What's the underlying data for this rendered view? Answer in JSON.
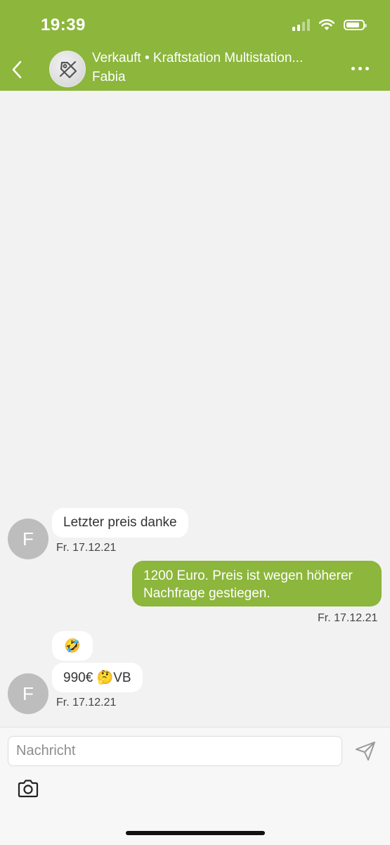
{
  "status_bar": {
    "time": "19:39"
  },
  "header": {
    "title": "Verkauft • Kraftstation Multistation...",
    "subtitle": "Fabia",
    "item_icon": "tag-icon"
  },
  "messages": [
    {
      "direction": "incoming",
      "avatar": "F",
      "text": "Letzter preis danke",
      "time": "Fr. 17.12.21"
    },
    {
      "direction": "outgoing",
      "text_lines": [
        "1200 Euro. Preis ist wegen höherer",
        "Nachfrage gestiegen."
      ],
      "time": "Fr. 17.12.21"
    },
    {
      "direction": "incoming",
      "avatar": "F",
      "bubbles": [
        "🤣",
        "990€ 🤔VB"
      ],
      "time": "Fr. 17.12.21"
    }
  ],
  "composer": {
    "placeholder": "Nachricht",
    "send_icon": "send-icon",
    "camera_icon": "camera-icon"
  },
  "colors": {
    "brand_green": "#8cb63c",
    "background": "#f2f2f2",
    "avatar_gray": "#bdbdbd"
  }
}
